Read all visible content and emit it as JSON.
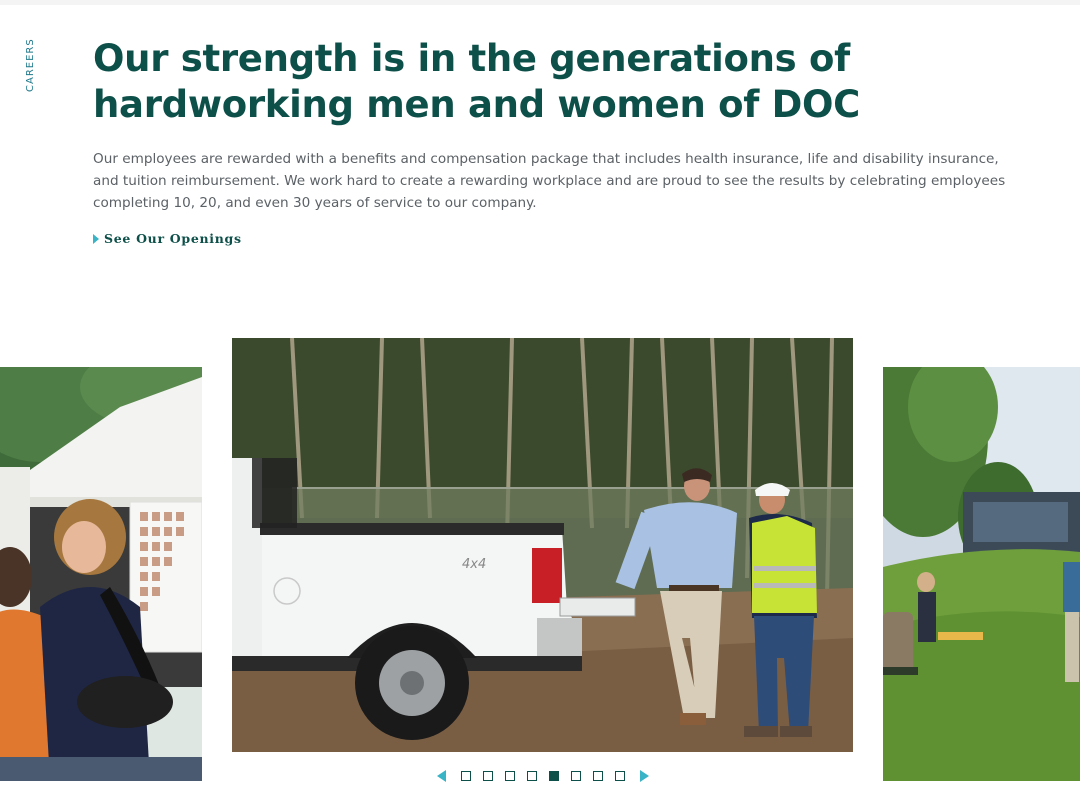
{
  "section_label": "CAREERS",
  "headline": "Our strength is in the generations of hardworking men and women of DOC",
  "body": "Our employees are rewarded with a benefits and compensation package that includes health insurance, life and disability insurance, and tuition reimbursement. We work hard to create a rewarding workplace and are proud to see the results by celebrating employees completing 10, 20, and even 30 years of service to our company.",
  "cta": {
    "label": "See Our Openings",
    "icon": "triangle-right-icon"
  },
  "carousel": {
    "slide_count": 8,
    "active_index": 4,
    "prev_icon": "triangle-left-icon",
    "next_icon": "triangle-right-icon",
    "truck_badge": "4x4"
  },
  "colors": {
    "heading": "#0d4f49",
    "body_text": "#5b6166",
    "accent": "#39b3c6",
    "side_label": "#1f7a8c"
  }
}
